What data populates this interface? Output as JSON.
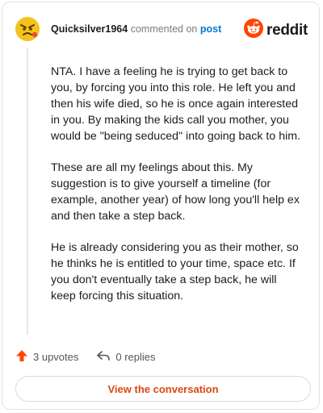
{
  "comment": {
    "username": "Quicksilver1964",
    "action_text": "commented on",
    "post_link": "post",
    "paragraphs": [
      "NTA. I have a feeling he is trying to get back to you, by forcing you into this role. He left you and then his wife died, so he is once again interested in you. By making the kids call you mother, you would be \"being seduced\" into going back to him.",
      "These are all my feelings about this. My suggestion is to give yourself a timeline (for example, another year) of how long you'll help ex and then take a step back.",
      "He is already considering you as their mother, so he thinks he is entitled to your time, space etc. If you don't eventually take a step back, he will keep forcing this situation."
    ]
  },
  "brand": {
    "name": "reddit",
    "color": "#ff4500"
  },
  "actions": {
    "upvotes": "3 upvotes",
    "replies": "0 replies"
  },
  "footer": {
    "view_button": "View the conversation"
  },
  "colors": {
    "accent_link": "#0079d3",
    "upvote": "#ff4500",
    "button_text": "#d9480f",
    "avatar_bg": "#f5c21b"
  },
  "icons": {
    "avatar": "angry-snoo-avatar",
    "upvote": "upvote-arrow-icon",
    "reply": "reply-arrow-icon",
    "logo": "reddit-snoo-icon"
  }
}
